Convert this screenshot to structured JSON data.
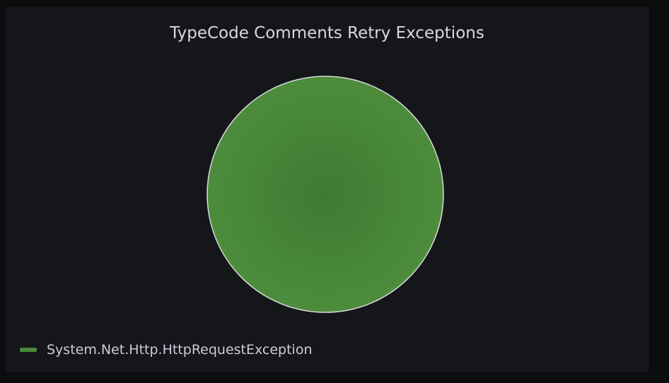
{
  "panel": {
    "title": "TypeCode Comments Retry Exceptions"
  },
  "chart_data": {
    "type": "pie",
    "title": "TypeCode Comments Retry Exceptions",
    "slices": [
      {
        "label": "System.Net.Http.HttpRequestException",
        "value": 1,
        "color": "#4a8a3a"
      }
    ],
    "legend": {
      "placement": "bottom-left",
      "items": [
        "System.Net.Http.HttpRequestException"
      ]
    },
    "slice_border_color": "#d8d9da"
  }
}
